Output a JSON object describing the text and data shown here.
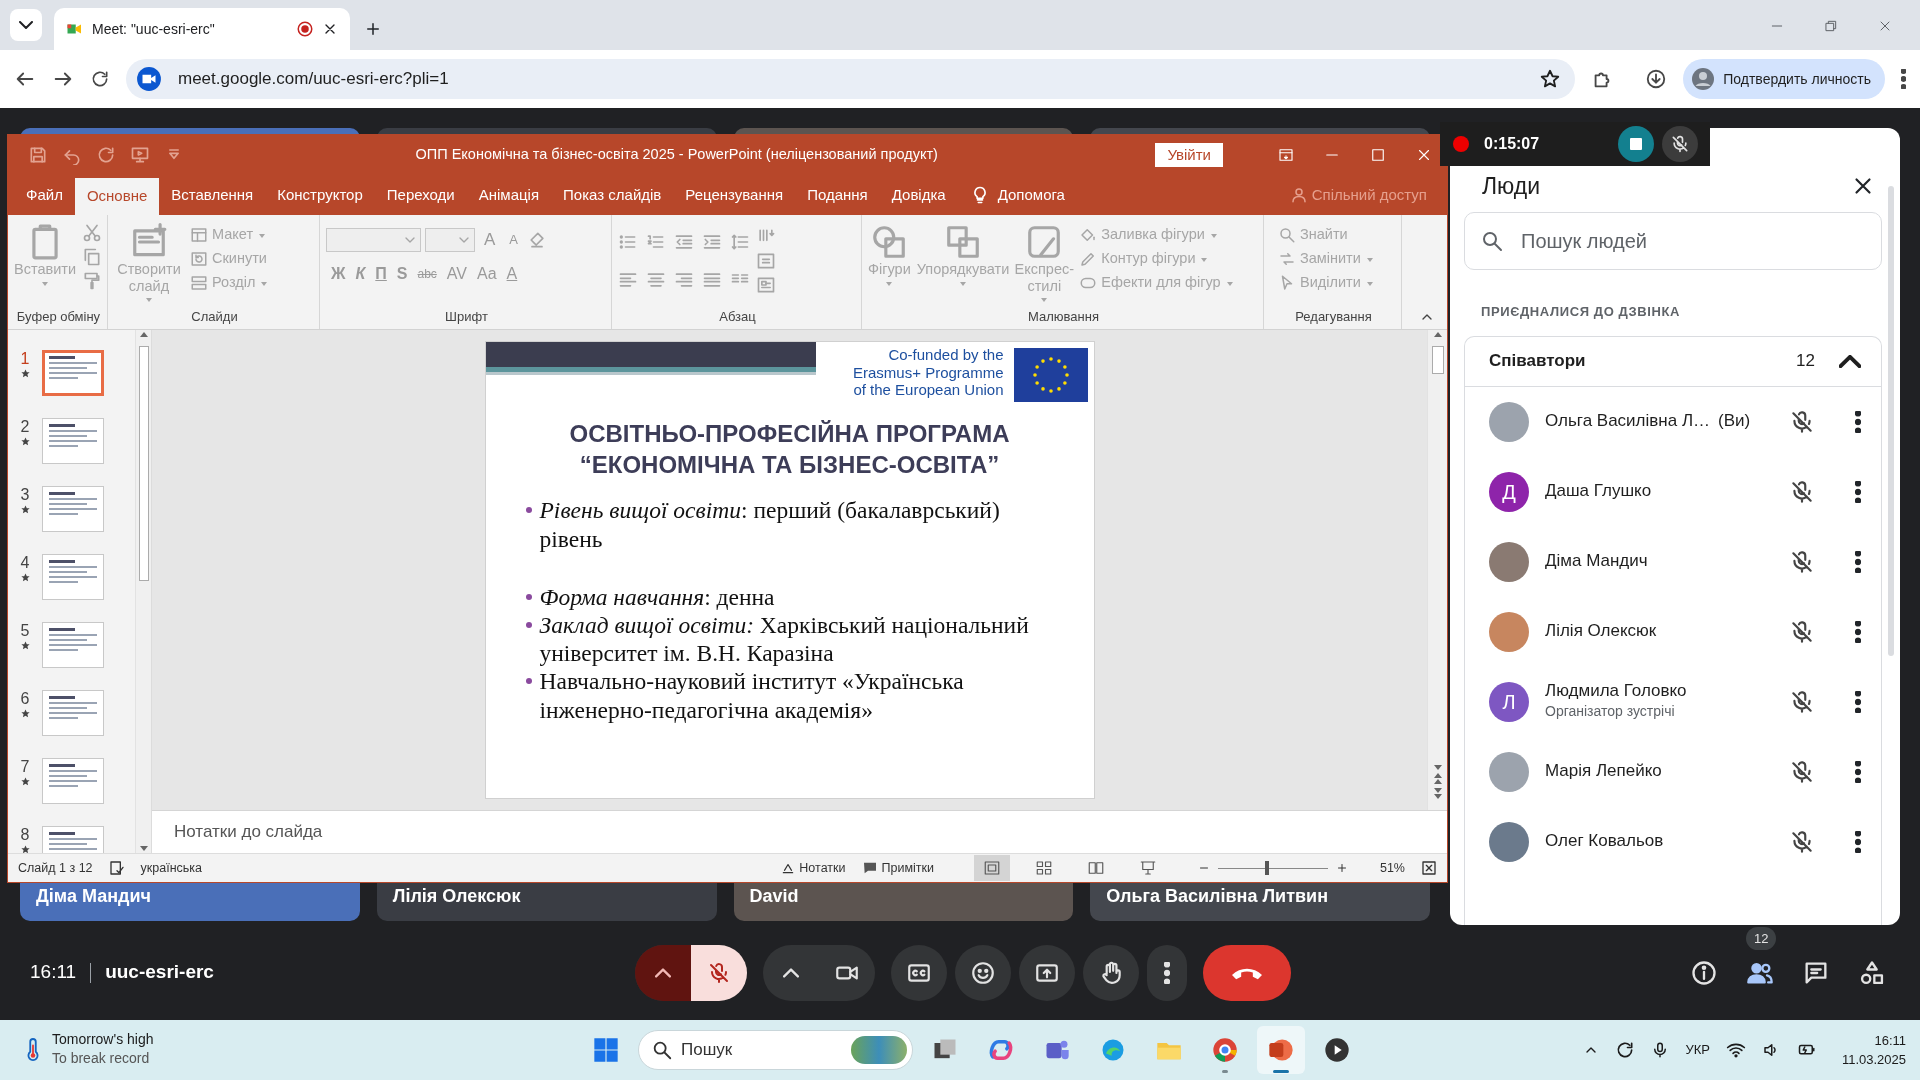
{
  "browser": {
    "tabs": [
      {
        "title": "Meet: \"uuc-esri-erc\"",
        "selected": true,
        "recording": true
      }
    ],
    "url": "meet.google.com/uuc-esri-erc?pli=1",
    "profile_button": "Подтвердить личность"
  },
  "powerpoint": {
    "title": "ОПП Економічна та бізнес-освіта 2025  -  PowerPoint (неліцензований продукт)",
    "login_button": "Увійти",
    "menu": [
      {
        "label": "Файл",
        "selected": false
      },
      {
        "label": "Основне",
        "selected": true
      },
      {
        "label": "Вставлення",
        "selected": false
      },
      {
        "label": "Конструктор",
        "selected": false
      },
      {
        "label": "Переходи",
        "selected": false
      },
      {
        "label": "Анімація",
        "selected": false
      },
      {
        "label": "Показ слайдів",
        "selected": false
      },
      {
        "label": "Рецензування",
        "selected": false
      },
      {
        "label": "Подання",
        "selected": false
      },
      {
        "label": "Довідка",
        "selected": false
      }
    ],
    "tell_me": "Допомога",
    "share": "Спільний доступ",
    "ribbon": [
      {
        "kind": "clipboard",
        "label": "Буфер обміну",
        "buttons": [
          "Вставити"
        ]
      },
      {
        "kind": "slides",
        "label": "Слайди",
        "buttons": [
          "Створити слайд"
        ],
        "commands": [
          "Макет",
          "Скинути",
          "Розділ"
        ]
      },
      {
        "kind": "font",
        "label": "Шрифт",
        "size_buttons": [
          "A",
          "A"
        ],
        "format_buttons": [
          "Ж",
          "К",
          "П",
          "S",
          "abc",
          "AV",
          "Aa",
          "A"
        ]
      },
      {
        "kind": "paragraph",
        "label": "Абзац"
      },
      {
        "kind": "drawing",
        "label": "Малювання",
        "buttons": [
          "Фігури",
          "Упорядкувати",
          "Експрес-стилі"
        ],
        "commands": [
          "Заливка фігури",
          "Контур фігури",
          "Ефекти для фігур"
        ]
      },
      {
        "kind": "editing",
        "label": "Редагування",
        "commands": [
          "Знайти",
          "Замінити",
          "Виділити"
        ]
      }
    ],
    "thumbnails": [
      {
        "number": "1",
        "selected": true
      },
      {
        "number": "2",
        "selected": false
      },
      {
        "number": "3",
        "selected": false
      },
      {
        "number": "4",
        "selected": false
      },
      {
        "number": "5",
        "selected": false
      },
      {
        "number": "6",
        "selected": false
      },
      {
        "number": "7",
        "selected": false
      },
      {
        "number": "8",
        "selected": false
      }
    ],
    "slide": {
      "funding": [
        "Co-funded by the",
        "Erasmus+ Programme",
        "of the European Union"
      ],
      "title": [
        "ОСВІТНЬО-ПРОФЕСІЙНА ПРОГРАМА",
        "“ЕКОНОМІЧНА ТА БІЗНЕС-ОСВІТА”"
      ],
      "bullets": [
        {
          "text": "*Рівень вищої освіти*: перший (бакалаврський) рівень",
          "gap_before": false
        },
        {
          "text": "*Форма навчання*: денна",
          "gap_before": true
        },
        {
          "text": "*Заклад вищої освіти:* Харківський національний університет ім. В.Н. Каразіна",
          "gap_before": false
        },
        {
          "text": "Навчально-науковий інститут «Українська інженерно-педагогічна академія»",
          "gap_before": false
        }
      ]
    },
    "notes": {
      "placeholder": "Нотатки до слайда"
    },
    "status": {
      "slide_counter": "Слайд 1 з 12",
      "language": "українська",
      "notes_button": "Нотатки",
      "comments_button": "Примітки",
      "zoom": "51%",
      "zoom_slider": {
        "level": 0.45
      }
    }
  },
  "meet": {
    "tiles": [
      {
        "name": "Діма Мандич"
      },
      {
        "name": "Лілія Олексюк"
      },
      {
        "name": "David"
      },
      {
        "name": "Ольга Василівна Литвин"
      }
    ],
    "recording": {
      "time": "0:15:07"
    },
    "people_panel": {
      "title": "Люди",
      "search": {
        "placeholder": "Пошук людей"
      },
      "section": "ПРИЄДНАЛИСЯ ДО ДЗВІНКА",
      "group": {
        "name": "Співавтори",
        "count": "12",
        "expanded": true
      },
      "participants": [
        {
          "name": "Ольга Василівна Л…",
          "suffix": "(Ви)",
          "kind": "photo",
          "muted": true
        },
        {
          "name": "Даша Глушко",
          "kind": "initial",
          "initial": "Д",
          "color": "#8e24aa",
          "muted": true
        },
        {
          "name": "Діма Мандич",
          "kind": "photo",
          "muted": true
        },
        {
          "name": "Лілія Олексюк",
          "kind": "photo",
          "muted": true
        },
        {
          "name": "Людмила Головко",
          "role": "Організатор зустрічі",
          "kind": "initial",
          "initial": "Л",
          "color": "#7e57c2",
          "muted": true
        },
        {
          "name": "Марія Лепейко",
          "kind": "photo",
          "muted": true
        },
        {
          "name": "Олег Ковальов",
          "kind": "photo",
          "muted": true
        }
      ]
    },
    "controls": {
      "clock": "16:11",
      "meeting_code": "uuc-esri-erc",
      "center_buttons": [
        {
          "kind": "mic",
          "muted": true
        },
        {
          "kind": "camera"
        },
        {
          "kind": "captions"
        },
        {
          "kind": "emoji"
        },
        {
          "kind": "present"
        },
        {
          "kind": "hand"
        },
        {
          "kind": "more"
        },
        {
          "kind": "end_call"
        }
      ],
      "side_buttons": [
        {
          "kind": "info",
          "selected": false
        },
        {
          "kind": "people",
          "selected": true,
          "badge": "12"
        },
        {
          "kind": "chat",
          "selected": false
        },
        {
          "kind": "activities",
          "selected": false
        }
      ]
    }
  },
  "taskbar": {
    "weather": {
      "title": "Tomorrow's high",
      "subtitle": "To break record"
    },
    "search": {
      "placeholder": "Пошук"
    },
    "apps": [
      {
        "kind": "task_view",
        "running": false,
        "selected": false
      },
      {
        "kind": "copilot",
        "running": false,
        "selected": false
      },
      {
        "kind": "teams",
        "running": false,
        "selected": false
      },
      {
        "kind": "edge",
        "running": false,
        "selected": false
      },
      {
        "kind": "explorer",
        "running": false,
        "selected": false
      },
      {
        "kind": "chrome",
        "running": true,
        "selected": false
      },
      {
        "kind": "powerpoint",
        "running": true,
        "selected": true
      },
      {
        "kind": "player",
        "running": false,
        "selected": false
      }
    ],
    "language": "УКР",
    "time": "16:11",
    "date": "11.03.2025"
  }
}
